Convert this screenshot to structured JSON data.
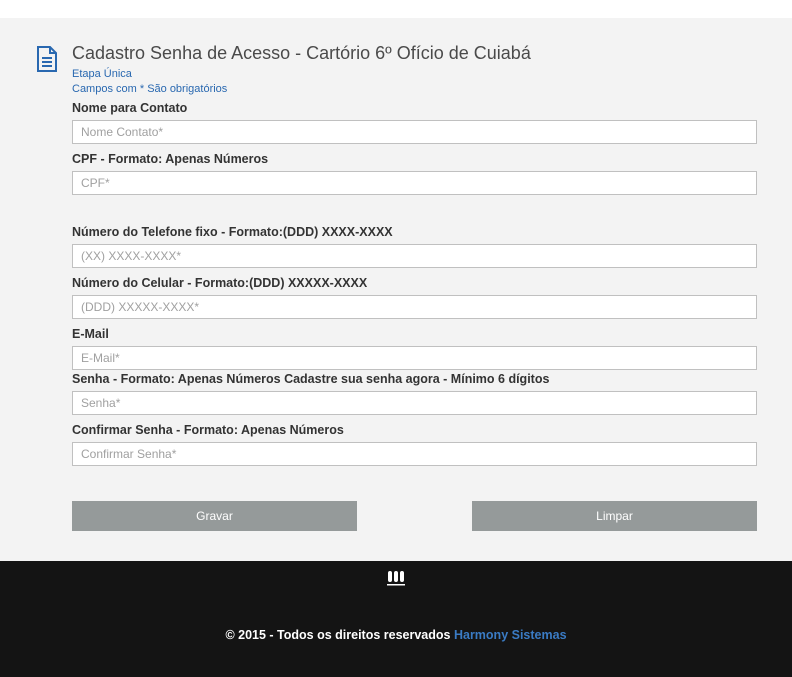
{
  "header": {
    "title": "Cadastro Senha de Acesso - Cartório 6º Ofício de Cuiabá",
    "step": "Etapa Única",
    "required_note": "Campos com * São obrigatórios"
  },
  "fields": {
    "nome": {
      "label": "Nome para Contato",
      "placeholder": "Nome Contato*"
    },
    "cpf": {
      "label": "CPF - Formato: Apenas Números",
      "placeholder": "CPF*"
    },
    "telefone": {
      "label": "Número do Telefone fixo - Formato:(DDD) XXXX-XXXX",
      "placeholder": "(XX) XXXX-XXXX*"
    },
    "celular": {
      "label": "Número do Celular - Formato:(DDD) XXXXX-XXXX",
      "placeholder": "(DDD) XXXXX-XXXX*"
    },
    "email": {
      "label": "E-Mail",
      "placeholder": "E-Mail*"
    },
    "senha": {
      "label": "Senha - Formato: Apenas Números Cadastre sua senha agora - Mínimo 6 dígitos",
      "placeholder": "Senha*"
    },
    "confirmar": {
      "label": "Confirmar Senha - Formato: Apenas Números",
      "placeholder": "Confirmar Senha*"
    }
  },
  "buttons": {
    "save": "Gravar",
    "clear": "Limpar"
  },
  "footer": {
    "copyright": "© 2015 - Todos os direitos reservados ",
    "link_text": "Harmony Sistemas"
  }
}
